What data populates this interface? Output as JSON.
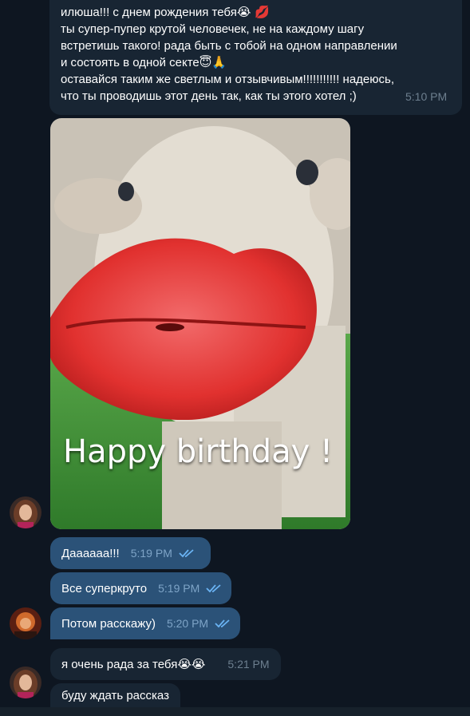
{
  "chat": {
    "first_message": {
      "line1": "илюша!!! с днем рождения тебя",
      "line1_emoji": "😭 💋",
      "line2": "ты супер-пупер крутой человечек, не на каждому шагу",
      "line3": "встретишь такого! рада быть с тобой на одном направлении",
      "line4": "и состоять в одной секте",
      "line4_emoji": "😇🙏",
      "line5": "оставайся таким же светлым и отзывчивым!!!!!!!!!!! надеюсь,",
      "line6": "что ты проводишь этот день так, как ты этого хотел ;)",
      "time": "5:10 PM"
    },
    "gif": {
      "caption": "Happy birthday !"
    },
    "outgoing": [
      {
        "text": "Даааааа!!!",
        "time": "5:19 PM"
      },
      {
        "text": "Все суперкруто",
        "time": "5:19 PM"
      },
      {
        "text": "Потом расскажу)",
        "time": "5:20 PM"
      }
    ],
    "incoming": [
      {
        "text": "я очень рада за тебя",
        "emoji": "😭😭",
        "time": "5:21 PM"
      },
      {
        "text": "буду ждать рассказ"
      }
    ]
  },
  "colors": {
    "background": "#0e1621",
    "incoming_bubble": "#182533",
    "outgoing_bubble": "#2b5278",
    "check_marks": "#6ab3f3"
  }
}
